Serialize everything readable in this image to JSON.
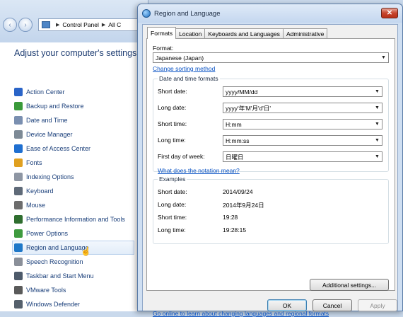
{
  "control_panel": {
    "nav": {
      "back": "‹",
      "forward": "›"
    },
    "breadcrumb": [
      "Control Panel",
      "All C"
    ],
    "heading": "Adjust your computer's settings",
    "items": [
      {
        "label": "Action Center",
        "icon": "flag-icon",
        "color": "#2a64c8"
      },
      {
        "label": "Backup and Restore",
        "icon": "backup-icon",
        "color": "#3a9a3a"
      },
      {
        "label": "Date and Time",
        "icon": "clock-icon",
        "color": "#7a8fb0"
      },
      {
        "label": "Device Manager",
        "icon": "device-manager-icon",
        "color": "#7d8a96"
      },
      {
        "label": "Ease of Access Center",
        "icon": "ease-of-access-icon",
        "color": "#1f6fd0"
      },
      {
        "label": "Fonts",
        "icon": "fonts-icon",
        "color": "#e0a020"
      },
      {
        "label": "Indexing Options",
        "icon": "indexing-icon",
        "color": "#8e96a3"
      },
      {
        "label": "Keyboard",
        "icon": "keyboard-icon",
        "color": "#5f6a78"
      },
      {
        "label": "Mouse",
        "icon": "mouse-icon",
        "color": "#6d6d6d"
      },
      {
        "label": "Performance Information and Tools",
        "icon": "performance-icon",
        "color": "#2f6e2f"
      },
      {
        "label": "Power Options",
        "icon": "power-icon",
        "color": "#3f9b3f"
      },
      {
        "label": "Region and Language",
        "icon": "globe-icon",
        "color": "#1f78c8"
      },
      {
        "label": "Speech Recognition",
        "icon": "microphone-icon",
        "color": "#8a8f99"
      },
      {
        "label": "Taskbar and Start Menu",
        "icon": "taskbar-icon",
        "color": "#4d5a6a"
      },
      {
        "label": "VMware Tools",
        "icon": "vmware-icon",
        "color": "#5a5a5a"
      },
      {
        "label": "Windows Defender",
        "icon": "defender-icon",
        "color": "#55606c"
      }
    ]
  },
  "dialog": {
    "title": "Region and Language",
    "close": "✕",
    "tabs": [
      "Formats",
      "Location",
      "Keyboards and Languages",
      "Administrative"
    ],
    "format_label": "Format:",
    "format_value": "Japanese (Japan)",
    "sorting_link": "Change sorting method",
    "datetime_group": "Date and time formats",
    "fields": {
      "short_date": {
        "label": "Short date:",
        "value": "yyyy/MM/dd"
      },
      "long_date": {
        "label": "Long date:",
        "value": "yyyy'年'M'月'd'日'"
      },
      "short_time": {
        "label": "Short time:",
        "value": "H:mm"
      },
      "long_time": {
        "label": "Long time:",
        "value": "H:mm:ss"
      },
      "first_day": {
        "label": "First day of week:",
        "value": "日曜日"
      }
    },
    "notation_link": "What does the notation mean?",
    "examples_group": "Examples",
    "examples": {
      "short_date": {
        "label": "Short date:",
        "value": "2014/09/24"
      },
      "long_date": {
        "label": "Long date:",
        "value": "2014年9月24日"
      },
      "short_time": {
        "label": "Short time:",
        "value": "19:28"
      },
      "long_time": {
        "label": "Long time:",
        "value": "19:28:15"
      }
    },
    "additional_button": "Additional settings...",
    "online_link": "Go online to learn about changing languages and regional formats",
    "buttons": {
      "ok": "OK",
      "cancel": "Cancel",
      "apply": "Apply"
    }
  }
}
